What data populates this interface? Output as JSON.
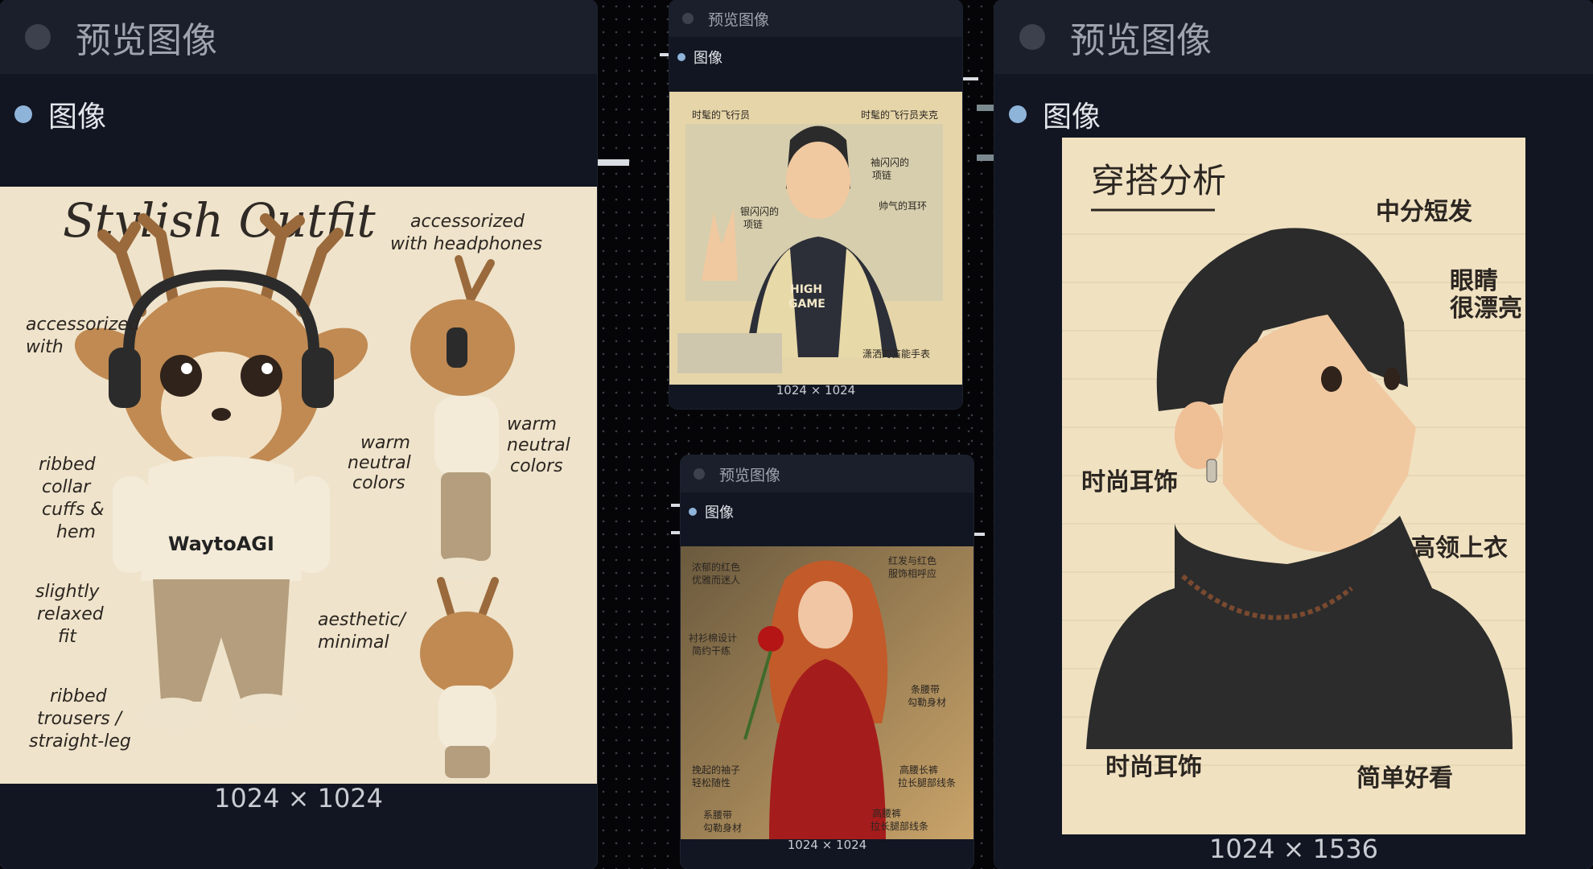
{
  "nodes": [
    {
      "title": "预览图像",
      "port_label": "图像",
      "image_size": "1024 × 1024",
      "image": {
        "subject": "deer-character-outfit",
        "heading": "Stylish Outfit",
        "sweater_text": "WaytoAGI",
        "labels": {
          "headphones": [
            "accessorized",
            "with headphones"
          ],
          "accessorized": [
            "accessorized",
            "with"
          ],
          "warm1": [
            "warm",
            "neutral",
            "colors"
          ],
          "warm2": [
            "warm",
            "neutral",
            "colors"
          ],
          "ribbed": [
            "ribbed",
            "collar",
            "cuffs &",
            "hem"
          ],
          "relaxed": [
            "slightly",
            "relaxed",
            "fit"
          ],
          "aesthetic": [
            "aesthetic/",
            "minimal"
          ],
          "trousers": [
            "ribbed",
            "trousers /",
            "straight-leg"
          ]
        }
      }
    },
    {
      "title": "预览图像",
      "port_label": "图像",
      "image_size": "1024 × 1024",
      "image": {
        "subject": "pilot-jacket-man",
        "labels": {
          "top_left": "时髦的飞行员",
          "top_right": "时髦的飞行员夹克",
          "chain": [
            "袖闪闪的",
            "项链"
          ],
          "necklace": [
            "银闪闪的",
            "项链"
          ],
          "earring": "帅气的耳环",
          "bottom": "潇洒的笛能手表",
          "shirt": [
            "HIGH",
            "GAME"
          ]
        }
      }
    },
    {
      "title": "预览图像",
      "port_label": "图像",
      "image_size": "1024 × 1024",
      "image": {
        "subject": "woman-red-dress-rose",
        "labels": {
          "hair": [
            "浓郁的红色",
            "优雅而迷人"
          ],
          "matching": [
            "红发与红色",
            "服饰相呼应"
          ],
          "shirt": [
            "衬衫棉设计",
            "简约干练"
          ],
          "belt1": [
            "条腰带",
            "勾勒身材"
          ],
          "sleeves": [
            "挽起的袖子",
            "轻松随性"
          ],
          "waist1": [
            "高腰长裤",
            "拉长腿部线条"
          ],
          "belt2": [
            "系腰带",
            "勾勒身材"
          ],
          "waist2": [
            "高腰裤",
            "拉长腿部线条"
          ]
        }
      }
    },
    {
      "title": "预览图像",
      "port_label": "图像",
      "image_size": "1024 × 1536",
      "image": {
        "subject": "man-profile-turtleneck",
        "heading": "穿搭分析",
        "labels": {
          "hair": "中分短发",
          "eyes": [
            "眼睛",
            "很漂亮"
          ],
          "earring1": "时尚耳饰",
          "collar": "高领上衣",
          "earring2": "时尚耳饰",
          "simple": "简单好看"
        }
      }
    }
  ]
}
